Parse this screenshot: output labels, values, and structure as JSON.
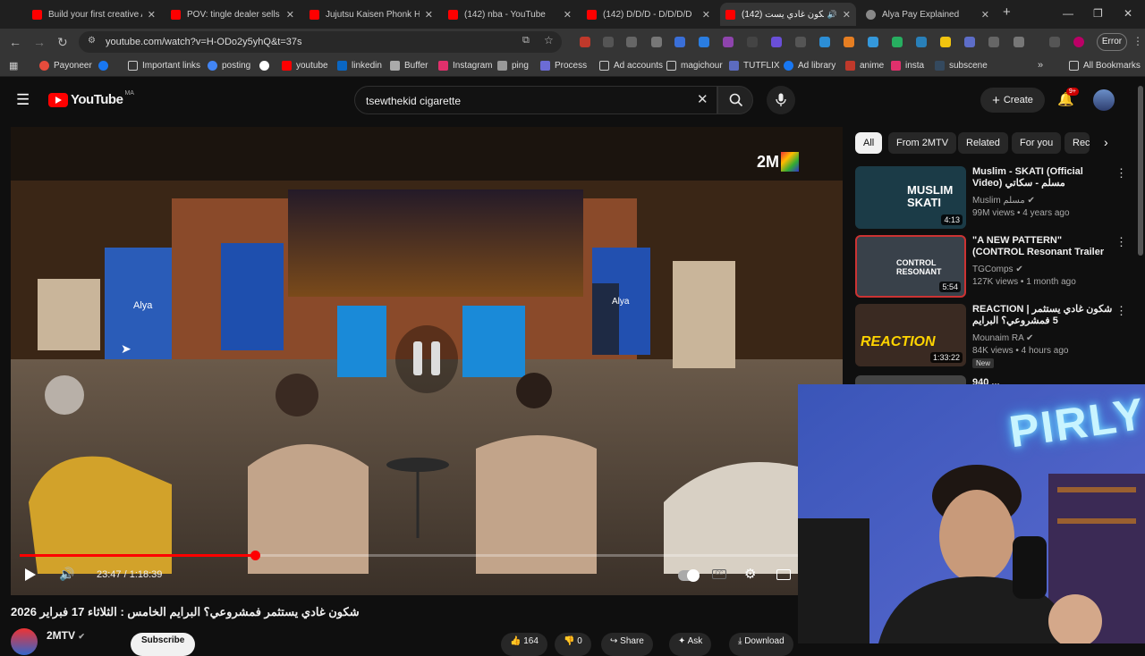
{
  "browser": {
    "tabs": [
      {
        "title": "Build your first creative A"
      },
      {
        "title": "POV: tingle dealer sells y"
      },
      {
        "title": "Jujutsu Kaisen Phonk HD"
      },
      {
        "title": "(142) nba - YouTube"
      },
      {
        "title": "(142) D/D/D - D/D/D/D"
      },
      {
        "title": "(142) شكون غادي يست"
      },
      {
        "title": "Alya Pay Explained"
      }
    ],
    "url": "youtube.com/watch?v=H-ODo2y5yhQ&t=37s",
    "error_label": "Error",
    "bookmarks": [
      "Payoneer",
      "Important links",
      "posting",
      "youtube",
      "linkedin",
      "Buffer",
      "Instagram",
      "ping",
      "Process",
      "Ad accounts",
      "magichour",
      "TUTFLIX",
      "Ad library",
      "anime",
      "insta",
      "subscene"
    ],
    "all_bookmarks": "All Bookmarks"
  },
  "youtube": {
    "logo_text": "YouTube",
    "logo_region": "MA",
    "search_value": "tsewthekid cigarette",
    "create_label": "Create",
    "notif_count": "9+"
  },
  "player": {
    "channel_watermark": "2M",
    "time": "23:47 / 1:18:39",
    "progress_fraction": 0.302,
    "set_brand": "Alya"
  },
  "video": {
    "title": "شكون غادي يستثمر فمشروعي؟ البرايم الخامس : الثلاثاء 17 فبراير 2026",
    "channel": "2MTV",
    "subscribe": "Subscribe",
    "likes": "164",
    "dislikes": "0",
    "share": "Share",
    "ask": "Ask",
    "download": "Download"
  },
  "chips": [
    "All",
    "From 2MTV",
    "Related",
    "For you",
    "Rec"
  ],
  "recommendations": [
    {
      "title": "Muslim - SKATI (Official Video) مسلم - سكاتي",
      "channel": "Muslim مسلم",
      "meta": "99M views • 4 years ago",
      "duration": "4:13",
      "thumb_text": "MUSLIM SKATI",
      "thumb_color": "#1b3b47"
    },
    {
      "title": "\"A NEW PATTERN\" (CONTROL Resonant Trailer Music Edit & ...",
      "channel": "TGComps",
      "meta": "127K views • 1 month ago",
      "duration": "5:54",
      "thumb_text": "CONTROL RESONANT",
      "thumb_color": "#39414a"
    },
    {
      "title": "REACTION | شكون غادي يستثمر 5 فمشروعي؟ البرايم",
      "channel": "Mounaim RA",
      "meta": "84K views • 4 hours ago",
      "duration": "1:33:22",
      "badge": "New",
      "thumb_text": "REACTION",
      "thumb_color": "#3a2a22"
    },
    {
      "title": "940 ...",
      "channel": "",
      "meta": "",
      "duration": "",
      "thumb_text": "",
      "thumb_color": "#444"
    }
  ],
  "webcam": {
    "neon_text": "PIRLY"
  }
}
